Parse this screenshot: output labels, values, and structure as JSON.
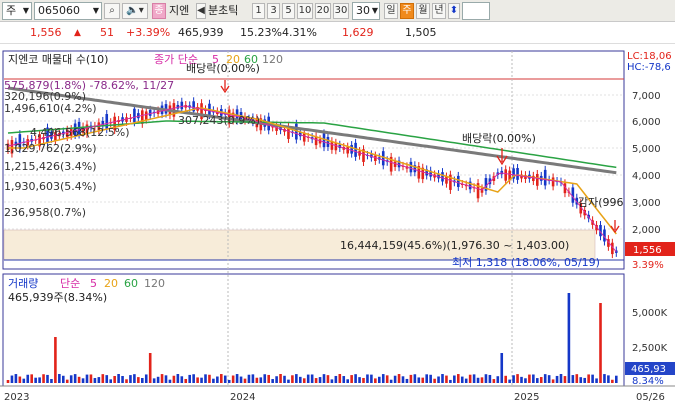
{
  "toolbar": {
    "type_label": "주",
    "code": "065060",
    "badge_j": "종",
    "stock_name": "지엔",
    "tick_label": "분초틱",
    "periods": [
      "1",
      "3",
      "5",
      "10",
      "20",
      "30"
    ],
    "period_select": "30",
    "day_label": "일",
    "week_label": "주",
    "month_label": "월",
    "year_label": "년"
  },
  "quote": {
    "price": "1,556",
    "arrow": "▲",
    "change": "51",
    "change_pct": "+3.39%",
    "volume": "465,939",
    "ratio1": "15.23%",
    "ratio2": "4.31%",
    "high": "1,629",
    "low": "1,505"
  },
  "price_panel": {
    "title": "지엔코 매물대 수(10)",
    "ma_label": "종가 단순",
    "ma_periods": [
      "5",
      "20",
      "60",
      "120"
    ],
    "right_lc": "LC:18,06",
    "right_hc": "HC:-78,6",
    "annotation_dividend1": "배당락(0.00%)",
    "annotation_dividend2": "배당락(0.00%)",
    "annotation_reduction": "감자(996",
    "annotation_high": "575,879(1.8%) -78.62%, 11/27",
    "volume_profile_summary": "16,444,159(45.6%)(1,976.30 ~ 1,403.00)",
    "low_label": "최저 1,318 (18.06%, 05/19)",
    "current_price_tag": "1,556",
    "current_pct_tag": "3.39%",
    "vp_labels": [
      "575,879(1.8%)",
      "320,196(0.9%)",
      "1,496,610(4.2%)",
      "4,496,568(12.5%)",
      "1,029,762(2.9%)",
      "307,243(0.9%)",
      "1,215,426(3.4%)",
      "1,930,603(5.4%)",
      "236,958(0.7%)"
    ],
    "y_ticks": [
      "7,000",
      "6,000",
      "5,000",
      "4,000",
      "3,000",
      "2,000"
    ]
  },
  "volume_panel": {
    "title": "거래량",
    "ma_label": "단순",
    "ma_periods": [
      "5",
      "20",
      "60",
      "120"
    ],
    "sub_label": "465,939주(8.34%)",
    "y_ticks": [
      "5,000K",
      "2,500K"
    ],
    "current_volume_tag": "465,93",
    "current_pct_tag": "8.34%"
  },
  "x_axis": {
    "labels": [
      "2023",
      "2024",
      "2025",
      "05/26"
    ]
  },
  "colors": {
    "up": "#e2231a",
    "down": "#1437c8",
    "ma5": "#d62aa5",
    "ma20": "#e8a317",
    "ma60": "#2aa344",
    "ma120": "#7a7a7a"
  }
}
